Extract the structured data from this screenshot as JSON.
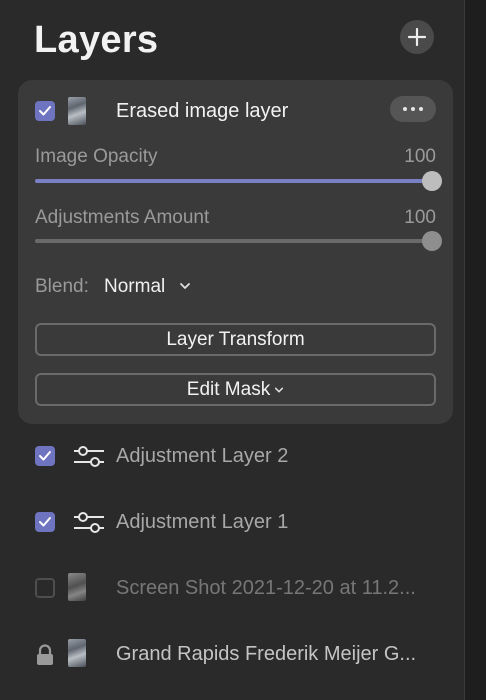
{
  "panel": {
    "title": "Layers"
  },
  "add_button": {
    "icon": "plus-icon"
  },
  "selected_layer": {
    "name": "Erased image layer",
    "checked": true,
    "more_icon": "more-horizontal-icon",
    "image_opacity": {
      "label": "Image Opacity",
      "value": "100",
      "level": 1.0
    },
    "adjustments_amount": {
      "label": "Adjustments Amount",
      "value": "100",
      "level": 1.0
    },
    "blend": {
      "label": "Blend:",
      "value": "Normal"
    },
    "layer_transform_label": "Layer Transform",
    "edit_mask_label": "Edit Mask"
  },
  "layers": [
    {
      "name": "Adjustment Layer 2",
      "checked": true,
      "type": "adjustment"
    },
    {
      "name": "Adjustment Layer 1",
      "checked": true,
      "type": "adjustment"
    },
    {
      "name": "Screen Shot 2021-12-20 at 11.2...",
      "checked": false,
      "type": "image"
    },
    {
      "name": "Grand Rapids Frederik Meijer G...",
      "locked": true,
      "type": "image"
    }
  ],
  "colors": {
    "accent": "#6e74c0",
    "background": "#2a2a2a",
    "card": "#3a3a3a"
  }
}
